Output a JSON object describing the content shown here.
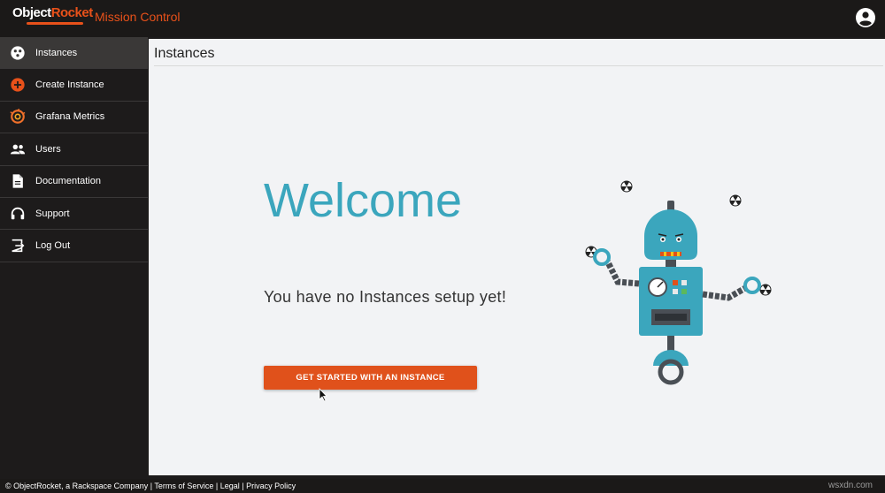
{
  "header": {
    "logo_text_a": "Object",
    "logo_text_b": "Rocket",
    "app_title": "Mission Control",
    "account_icon": "account-circle-icon"
  },
  "sidebar": {
    "items": [
      {
        "label": "Instances",
        "icon": "instances-icon",
        "active": true
      },
      {
        "label": "Create Instance",
        "icon": "add-circle-icon",
        "active": false
      },
      {
        "label": "Grafana Metrics",
        "icon": "grafana-icon",
        "active": false
      },
      {
        "label": "Users",
        "icon": "users-icon",
        "active": false
      },
      {
        "label": "Documentation",
        "icon": "document-icon",
        "active": false
      },
      {
        "label": "Support",
        "icon": "headset-icon",
        "active": false
      },
      {
        "label": "Log Out",
        "icon": "logout-icon",
        "active": false
      }
    ]
  },
  "main": {
    "page_title": "Instances",
    "welcome": "Welcome",
    "subtext": "You have no Instances setup yet!",
    "cta_label": "GET STARTED WITH AN INSTANCE"
  },
  "footer": {
    "company": "© ObjectRocket, a Rackspace Company",
    "sep": " | ",
    "terms": "Terms of Service",
    "legal": "Legal",
    "privacy": "Privacy Policy",
    "watermark": "wsxdn.com"
  },
  "colors": {
    "accent_orange": "#e0511b",
    "welcome_teal": "#3ba6bd",
    "sidebar_bg": "#1d1b1b",
    "content_bg": "#f2f3f5"
  }
}
